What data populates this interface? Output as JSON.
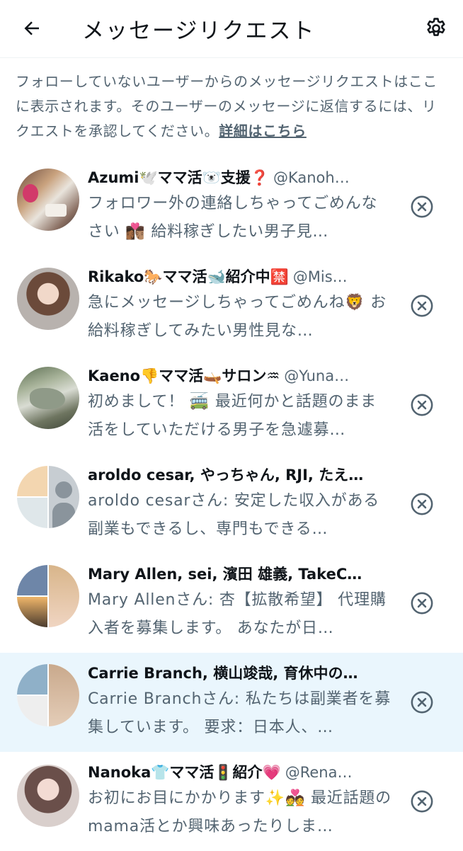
{
  "header": {
    "title": "メッセージリクエスト"
  },
  "notice": {
    "text": "フォローしていないユーザーからのメッセージリクエストはここに表示されます。そのユーザーのメッセージに返信するには、リクエストを承認してください。",
    "link": "詳細はこちら"
  },
  "requests": [
    {
      "name": "Azumi🕊️ママ活🐻‍❄️支援❓",
      "handle": "@Kanoh…",
      "message": "フォロワー外の連絡しちゃってごめんなさい 👩🏾‍❤️‍💋‍👨🏽 給料稼ぎしたい男子見…"
    },
    {
      "name": "Rikako🐎ママ活🐋紹介中🈲",
      "handle": "@Mis…",
      "message": "急にメッセージしちゃってごめんね🦁 お給料稼ぎしてみたい男性見な…"
    },
    {
      "name": "Kaeno👎ママ活🛶サロン♒",
      "handle": "@Yuna…",
      "message": "初めまして！ 🚎 最近何かと話題のまま活をしていただける男子を急遽募…"
    },
    {
      "name": "aroldo cesar, やっちゃん, RJI, たえ…",
      "handle": "",
      "message": "aroldo cesarさん: 安定した収入がある  副業もできるし、専門もできる…"
    },
    {
      "name": "Mary Allen, sei, 濱田 雄義, TakeC…",
      "handle": "",
      "message": "Mary Allenさん: 杏【拡散希望】 代理購入者を募集します。 あなたが日…"
    },
    {
      "name": "Carrie Branch, 横山竣哉, 育休中の…",
      "handle": "",
      "message": "Carrie Branchさん: 私たちは副業者を募集しています。  要求：日本人、…"
    },
    {
      "name": "Nanoka👕ママ活🚦紹介💗",
      "handle": "@Rena…",
      "message": "お初にお目にかかります✨💑 最近話題のmama活とか興味あったりしま…"
    }
  ],
  "colors": {
    "text_primary": "#0f1419",
    "text_secondary": "#536471",
    "highlight_row": "#eaf6fd",
    "divider": "#eff3f4"
  },
  "icons": {
    "back": "arrow-left-icon",
    "settings": "gear-icon",
    "dismiss": "close-circle-icon"
  }
}
